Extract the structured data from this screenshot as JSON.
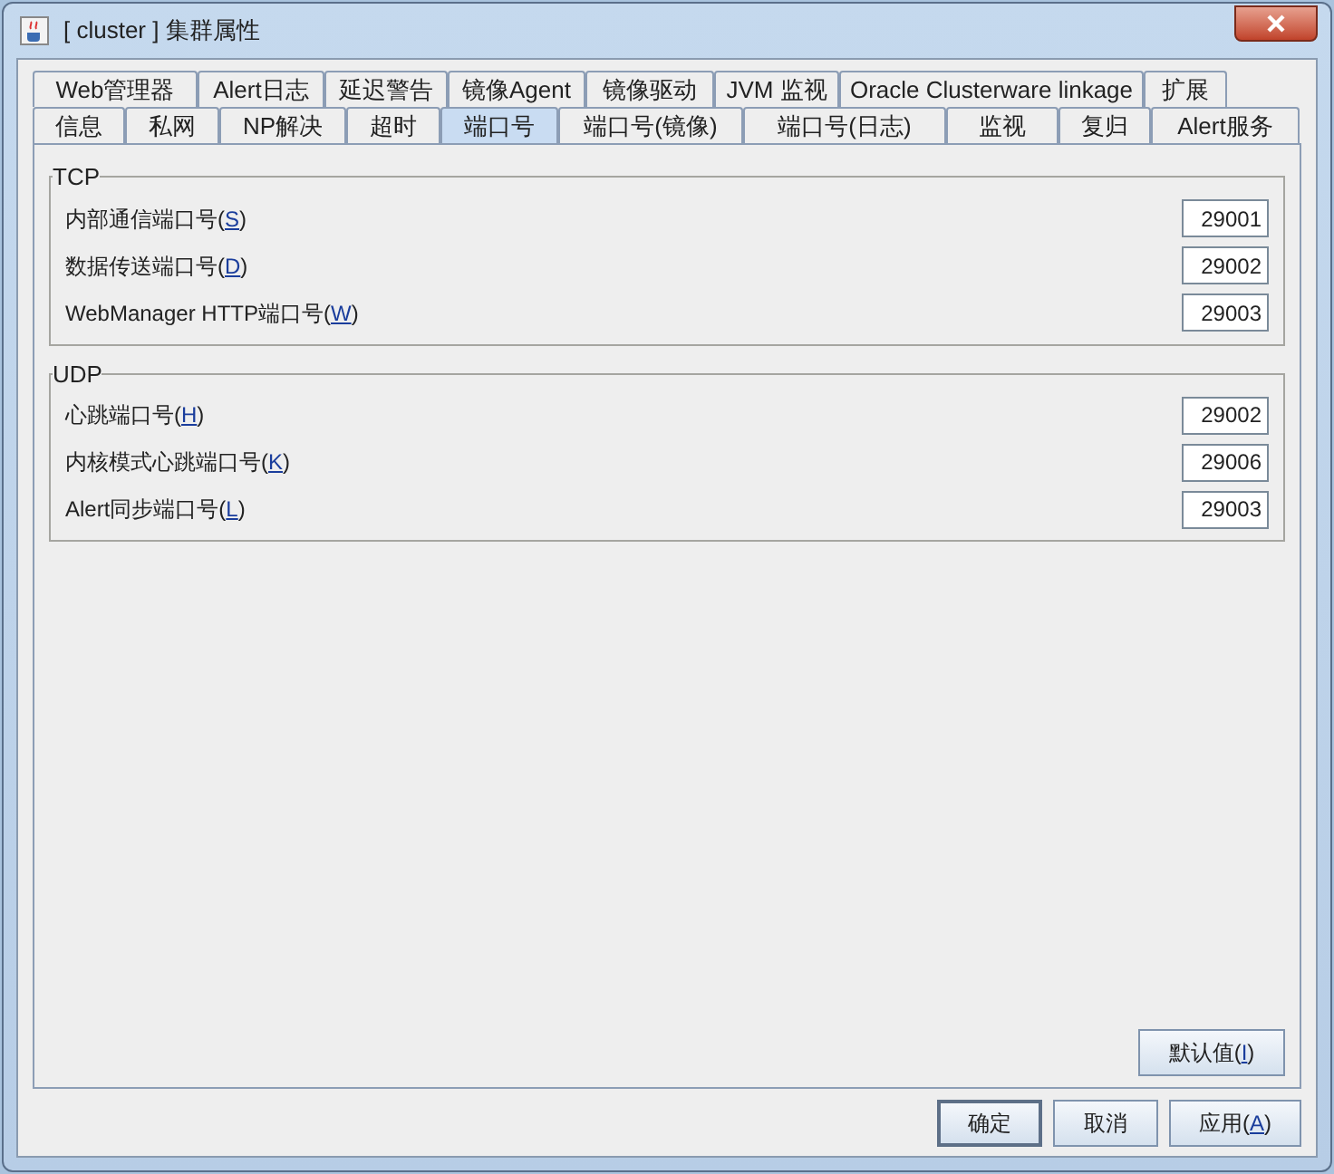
{
  "window": {
    "title": "[ cluster ] 集群属性"
  },
  "tab_rows": [
    [
      {
        "label": "Web管理器",
        "selected": false
      },
      {
        "label": "Alert日志",
        "selected": false
      },
      {
        "label": "延迟警告",
        "selected": false
      },
      {
        "label": "镜像Agent",
        "selected": false
      },
      {
        "label": "镜像驱动",
        "selected": false
      },
      {
        "label": "JVM 监视",
        "selected": false
      },
      {
        "label": "Oracle Clusterware linkage",
        "selected": false
      },
      {
        "label": "扩展",
        "selected": false
      }
    ],
    [
      {
        "label": "信息",
        "selected": false
      },
      {
        "label": "私网",
        "selected": false
      },
      {
        "label": "NP解决",
        "selected": false
      },
      {
        "label": "超时",
        "selected": false
      },
      {
        "label": "端口号",
        "selected": true
      },
      {
        "label": "端口号(镜像)",
        "selected": false
      },
      {
        "label": "端口号(日志)",
        "selected": false
      },
      {
        "label": "监视",
        "selected": false
      },
      {
        "label": "复归",
        "selected": false
      },
      {
        "label": "Alert服务",
        "selected": false
      }
    ]
  ],
  "groups": [
    {
      "title": "TCP",
      "fields": [
        {
          "label": "内部通信端口号(",
          "mnemonic": "S",
          "suffix": ")",
          "value": "29001"
        },
        {
          "label": "数据传送端口号(",
          "mnemonic": "D",
          "suffix": ")",
          "value": "29002"
        },
        {
          "label": "WebManager HTTP端口号(",
          "mnemonic": "W",
          "suffix": ")",
          "value": "29003"
        }
      ]
    },
    {
      "title": "UDP",
      "fields": [
        {
          "label": "心跳端口号(",
          "mnemonic": "H",
          "suffix": ")",
          "value": "29002"
        },
        {
          "label": "内核模式心跳端口号(",
          "mnemonic": "K",
          "suffix": ")",
          "value": "29006"
        },
        {
          "label": "Alert同步端口号(",
          "mnemonic": "L",
          "suffix": ")",
          "value": "29003"
        }
      ]
    }
  ],
  "default_button": {
    "label": "默认值(",
    "mnemonic": "I",
    "suffix": ")"
  },
  "buttons": [
    {
      "label": "确定",
      "focused": true
    },
    {
      "label": "取消",
      "focused": false
    },
    {
      "label": "应用(",
      "mnemonic": "A",
      "suffix": ")",
      "focused": false
    }
  ]
}
